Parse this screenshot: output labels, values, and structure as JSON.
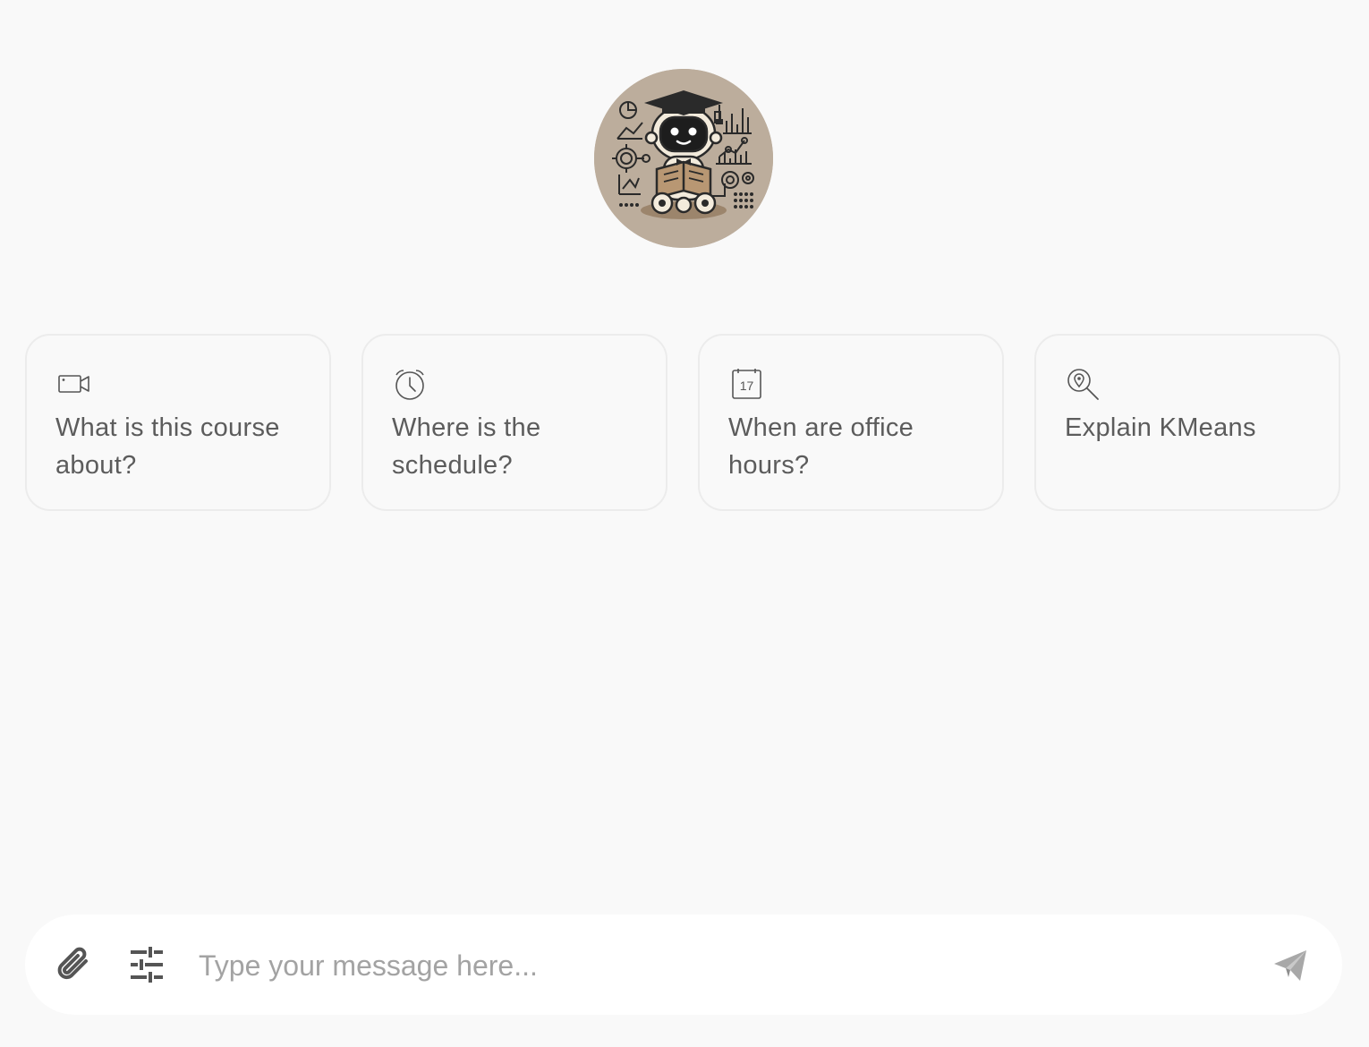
{
  "avatar": {
    "icon": "robot-graduate-avatar",
    "background": "#bcad9c"
  },
  "suggestions": [
    {
      "icon": "video-camera-icon",
      "label": "What is this course about?"
    },
    {
      "icon": "alarm-clock-icon",
      "label": "Where is the schedule?"
    },
    {
      "icon": "calendar-icon",
      "label": "When are office hours?",
      "calendar_day": "17"
    },
    {
      "icon": "location-search-icon",
      "label": "Explain KMeans"
    }
  ],
  "composer": {
    "placeholder": "Type your message here...",
    "value": "",
    "attach_icon": "paperclip-icon",
    "settings_icon": "sliders-icon",
    "send_icon": "send-icon"
  },
  "colors": {
    "background": "#f9f9f9",
    "card_border": "#ececec",
    "text": "#5c5c5c",
    "placeholder": "#a3a3a3",
    "icon": "#555555",
    "send_icon": "#a8a8a8"
  }
}
